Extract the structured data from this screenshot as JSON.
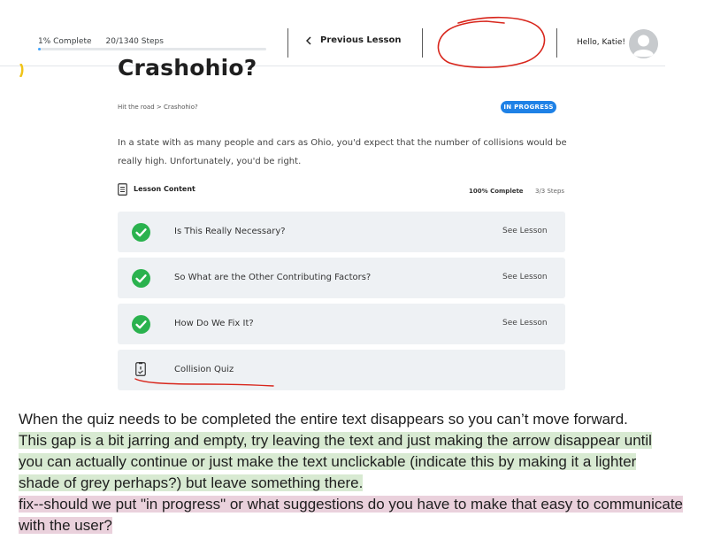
{
  "topbar": {
    "progress_label": "1% Complete",
    "steps_label": "20/1340 Steps",
    "progress_percent": 1,
    "previous_lesson_label": "Previous Lesson",
    "greeting": "Hello, Katie!"
  },
  "lesson": {
    "title": "Crashohio?",
    "breadcrumb": "Hit the road > Crashohio?",
    "status": "IN PROGRESS",
    "intro": "In a state with as many people and cars as Ohio, you'd expect that the number of collisions would be really high. Unfortunately, you'd be right.",
    "content_label": "Lesson Content",
    "content_complete": "100% Complete",
    "content_steps": "3/3 Steps",
    "topics": [
      {
        "title": "Is This Really Necessary?",
        "action": "See Lesson"
      },
      {
        "title": "So What are the Other Contributing Factors?",
        "action": "See Lesson"
      },
      {
        "title": "How Do We Fix It?",
        "action": "See Lesson"
      },
      {
        "title": "Collision Quiz",
        "action": ""
      }
    ]
  },
  "comment": {
    "line1": "When the quiz needs to be completed the entire text disappears so you can’t move forward.",
    "green_lines": [
      "This gap is a bit jarring and empty, try leaving the text and just making the arrow disappear until",
      "you can actually continue or just make the text unclickable (indicate this by making it a lighter",
      "shade of grey perhaps?) but leave something there."
    ],
    "pink_lines": [
      "fix--should we put \"in progress\" or what suggestions do you have to make that easy to communicate",
      "with the user?"
    ]
  },
  "colors": {
    "accent": "#1e81e6",
    "progress": "#3fa4ff",
    "check": "#2ab24e",
    "annotation_red": "#d8261c",
    "highlight_green": "#d8ead2",
    "highlight_pink": "#ead1dc"
  },
  "icons": {
    "previous": "chevron-left-icon",
    "avatar": "user-avatar-icon",
    "content": "document-icon",
    "completed": "check-circle-icon",
    "quiz": "quiz-icon"
  }
}
